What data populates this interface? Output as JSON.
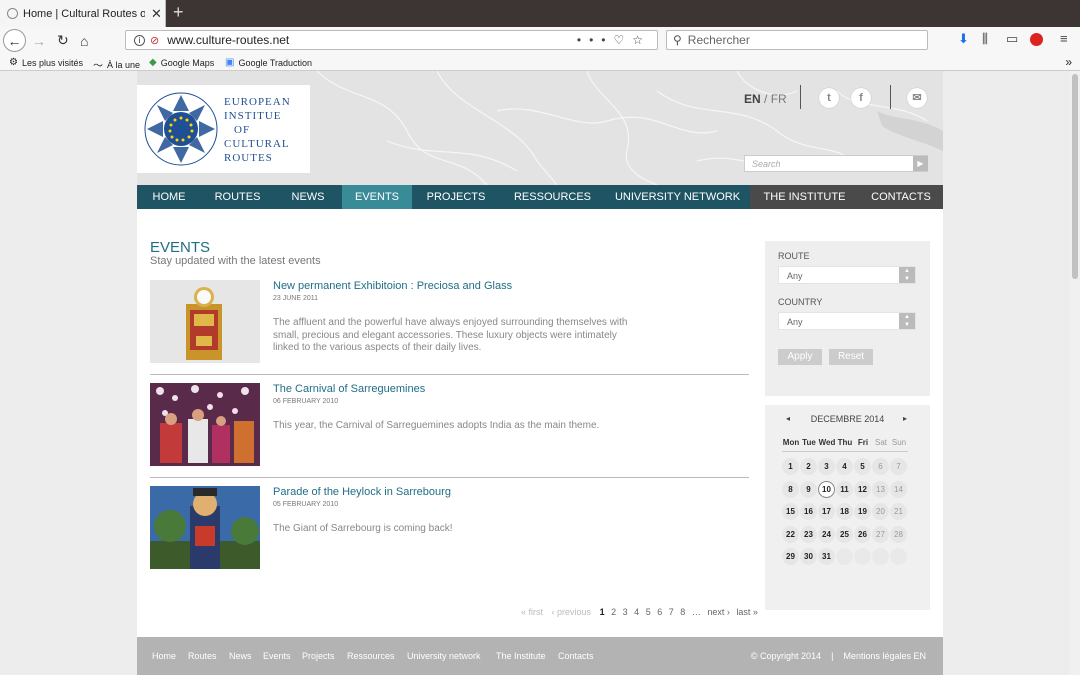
{
  "browser": {
    "tab_title": "Home | Cultural Routes of the C",
    "url": "www.culture-routes.net",
    "search_placeholder": "Rechercher",
    "bookmarks": [
      "Les plus visités",
      "À la une",
      "Google Maps",
      "Google Traduction"
    ]
  },
  "header": {
    "logo_lines": [
      "EUROPEAN",
      "INSTITUE",
      "OF",
      "CULTURAL",
      "ROUTES"
    ],
    "lang_en": "EN",
    "lang_sep": "/",
    "lang_fr": "FR",
    "search_placeholder": "Search",
    "social": [
      "twitter-icon",
      "facebook-icon",
      "mail-icon"
    ]
  },
  "nav": [
    "HOME",
    "ROUTES",
    "NEWS",
    "EVENTS",
    "PROJECTS",
    "RESSOURCES",
    "UNIVERSITY NETWORK",
    "THE INSTITUTE",
    "CONTACTS"
  ],
  "events": {
    "title": "EVENTS",
    "subtitle": "Stay updated with the latest events",
    "items": [
      {
        "title": "New permanent Exhibitoion : Preciosa and Glass",
        "date": "23 JUNE 2011",
        "desc": "The affluent and the powerful have always enjoyed surrounding themselves with small, precious and elegant accessories. These luxury objects were intimately linked to the various aspects of their daily lives."
      },
      {
        "title": "The Carnival of Sarreguemines",
        "date": "06 FEBRUARY 2010",
        "desc": "This year, the Carnival of Sarreguemines adopts India as the main theme."
      },
      {
        "title": "Parade of the Heylock in Sarrebourg",
        "date": "05 FEBRUARY 2010",
        "desc": "The Giant of Sarrebourg is coming back!"
      }
    ]
  },
  "pager": {
    "first": "« first",
    "previous": "‹ previous",
    "pages": [
      "1",
      "2",
      "3",
      "4",
      "5",
      "6",
      "7",
      "8"
    ],
    "current": "1",
    "ellipsis": "…",
    "next": "next ›",
    "last": "last »"
  },
  "filters": {
    "route_label": "ROUTE",
    "route_value": "Any",
    "country_label": "COUNTRY",
    "country_value": "Any",
    "apply": "Apply",
    "reset": "Reset"
  },
  "calendar": {
    "month": "DECEMBRE 2014",
    "prev": "◂",
    "next": "▸",
    "weekdays": [
      "Mon",
      "Tue",
      "Wed",
      "Thu",
      "Fri",
      "Sat",
      "Sun"
    ],
    "days": [
      "1",
      "2",
      "3",
      "4",
      "5",
      "6",
      "7",
      "8",
      "9",
      "10",
      "11",
      "12",
      "13",
      "14",
      "15",
      "16",
      "17",
      "18",
      "19",
      "20",
      "21",
      "22",
      "23",
      "24",
      "25",
      "26",
      "27",
      "28",
      "29",
      "30",
      "31"
    ],
    "today": "10"
  },
  "footer": {
    "links": [
      "Home",
      "Routes",
      "News",
      "Events",
      "Projects",
      "Ressources",
      "University network",
      "The Institute",
      "Contacts"
    ],
    "copyright": "© Copyright 2014",
    "sep": "|",
    "legal": "Mentions légales EN"
  },
  "colors": {
    "nav_bg": "#1e5464",
    "nav_active": "#3a8b98",
    "nav_dark": "#4a4a4a",
    "link_teal": "#1f6e86",
    "logo_blue": "#1f4f94"
  }
}
